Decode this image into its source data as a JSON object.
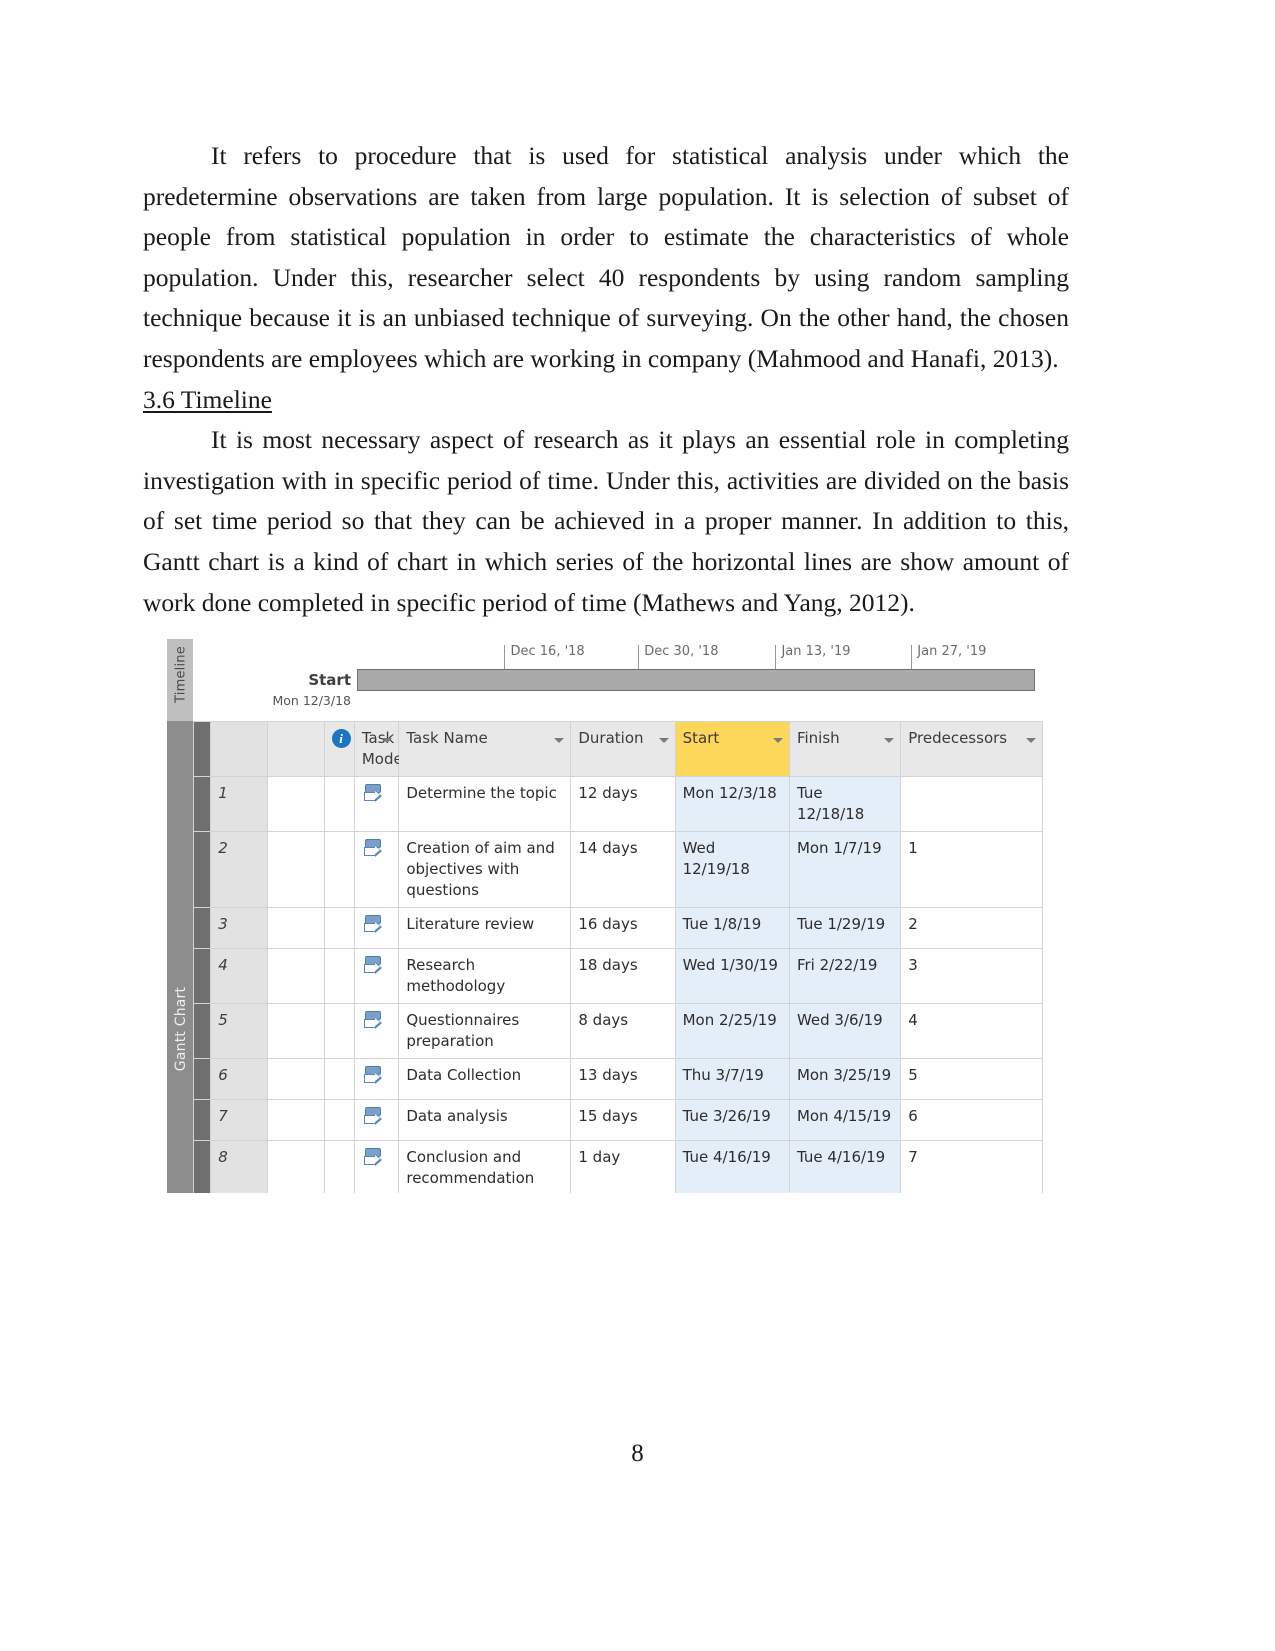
{
  "document": {
    "paragraph_1": "It refers to procedure that is used for statistical analysis under which the predetermine observations are taken from large population. It is selection of subset of people from statistical population in order to estimate the characteristics of whole population. Under this, researcher select 40 respondents by using random sampling technique because it is an unbiased technique of surveying. On the other hand, the chosen respondents are employees which are working in company (Mahmood and Hanafi, 2013).",
    "heading_3_6": "3.6 Timeline",
    "paragraph_2": "It is most necessary aspect of research as it plays an essential role in completing investigation with in specific period of time. Under this, activities are divided on the basis of set time period so that they can be achieved in a proper manner. In addition to this, Gantt chart is a kind of chart in which series of the horizontal lines are show amount of work done completed in specific period of time (Mathews and Yang, 2012).",
    "page_number": "8"
  },
  "gantt": {
    "side_tabs": {
      "timeline": "Timeline",
      "gantt_chart": "Gantt Chart"
    },
    "timeline": {
      "start_label": "Start",
      "start_date": "Mon 12/3/18",
      "ticks": [
        {
          "label": "Dec 16, '18",
          "left_pct": 21.5
        },
        {
          "label": "Dec 30, '18",
          "left_pct": 41.0
        },
        {
          "label": "Jan 13, '19",
          "left_pct": 61.0
        },
        {
          "label": "Jan 27, '19",
          "left_pct": 80.8
        }
      ]
    },
    "table": {
      "info_icon": "info-icon",
      "headers": {
        "task_mode": "Task Mode",
        "task_name": "Task Name",
        "duration": "Duration",
        "start": "Start",
        "finish": "Finish",
        "predecessors": "Predecessors"
      },
      "selected_column": "Start",
      "selected_column_color": "#fdd75a",
      "rows": [
        {
          "id": "1",
          "name": "Determine the topic",
          "duration": "12 days",
          "start": "Mon 12/3/18",
          "finish": "Tue 12/18/18",
          "predecessors": ""
        },
        {
          "id": "2",
          "name": "Creation of aim and objectives with questions",
          "duration": "14 days",
          "start": "Wed 12/19/18",
          "finish": "Mon 1/7/19",
          "predecessors": "1"
        },
        {
          "id": "3",
          "name": "Literature review",
          "duration": "16 days",
          "start": "Tue 1/8/19",
          "finish": "Tue 1/29/19",
          "predecessors": "2"
        },
        {
          "id": "4",
          "name": "Research methodology",
          "duration": "18 days",
          "start": "Wed 1/30/19",
          "finish": "Fri 2/22/19",
          "predecessors": "3"
        },
        {
          "id": "5",
          "name": "Questionnaires preparation",
          "duration": "8 days",
          "start": "Mon 2/25/19",
          "finish": "Wed 3/6/19",
          "predecessors": "4"
        },
        {
          "id": "6",
          "name": "Data Collection",
          "duration": "13 days",
          "start": "Thu 3/7/19",
          "finish": "Mon 3/25/19",
          "predecessors": "5"
        },
        {
          "id": "7",
          "name": "Data analysis",
          "duration": "15 days",
          "start": "Tue 3/26/19",
          "finish": "Mon 4/15/19",
          "predecessors": "6"
        },
        {
          "id": "8",
          "name": "Conclusion and recommendation",
          "duration": "1 day",
          "start": "Tue 4/16/19",
          "finish": "Tue 4/16/19",
          "predecessors": "7"
        }
      ]
    }
  }
}
